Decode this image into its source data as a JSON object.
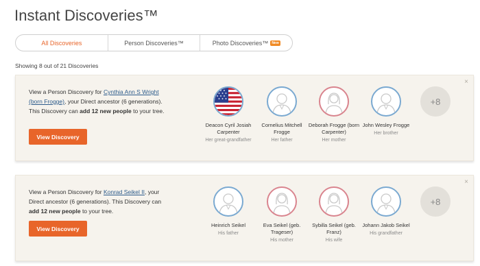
{
  "page": {
    "title": "Instant Discoveries™"
  },
  "tabs": [
    {
      "label": "All Discoveries",
      "active": true
    },
    {
      "label": "Person Discoveries™"
    },
    {
      "label": "Photo Discoveries™",
      "badge": "New"
    }
  ],
  "showing_text": "Showing 8 out of 21 Discoveries",
  "colors": {
    "accent": "#e8652a",
    "card_bg": "#f6f3ed",
    "link": "#2b5a8a",
    "male_ring": "#7aa9d1",
    "female_ring": "#d9848e"
  },
  "cards": [
    {
      "text_before": "View a Person Discovery for ",
      "link": "Cynthia Ann S Wright (born Frogge)",
      "text_middle": ", your Direct ancestor (6 generations). This Discovery can ",
      "bold": "add 12 new people",
      "text_after": " to your tree.",
      "button": "View Discovery",
      "close_icon": "×",
      "people": [
        {
          "name": "Deacon Cyril Josiah Carpenter",
          "relation": "Her great-grandfather",
          "gender": "flag",
          "icon": "us-flag-avatar"
        },
        {
          "name": "Cornelius Mitchell Frogge",
          "relation": "Her father",
          "gender": "male",
          "icon": "male-silhouette-icon"
        },
        {
          "name": "Deborah Frogge (born Carpenter)",
          "relation": "Her mother",
          "gender": "female",
          "icon": "female-silhouette-icon"
        },
        {
          "name": "John Wesley Frogge",
          "relation": "Her brother",
          "gender": "male",
          "icon": "male-silhouette-icon"
        }
      ],
      "more": "+8"
    },
    {
      "text_before": "View a Person Discovery for ",
      "link": "Konrad Seikel II",
      "text_middle": ", your Direct ancestor (6 generations). This Discovery can ",
      "bold": "add 12 new people",
      "text_after": " to your tree.",
      "button": "View Discovery",
      "close_icon": "×",
      "people": [
        {
          "name": "Heinrich Seikel",
          "relation": "His father",
          "gender": "male",
          "icon": "male-silhouette-icon"
        },
        {
          "name": "Eva Seikel (geb. Trageser)",
          "relation": "His mother",
          "gender": "female",
          "icon": "female-silhouette-icon"
        },
        {
          "name": "Sybilla Seikel (geb. Franz)",
          "relation": "His wife",
          "gender": "female",
          "icon": "female-silhouette-icon"
        },
        {
          "name": "Johann Jakob Seikel",
          "relation": "His grandfather",
          "gender": "male",
          "icon": "male-silhouette-icon"
        }
      ],
      "more": "+8"
    }
  ]
}
